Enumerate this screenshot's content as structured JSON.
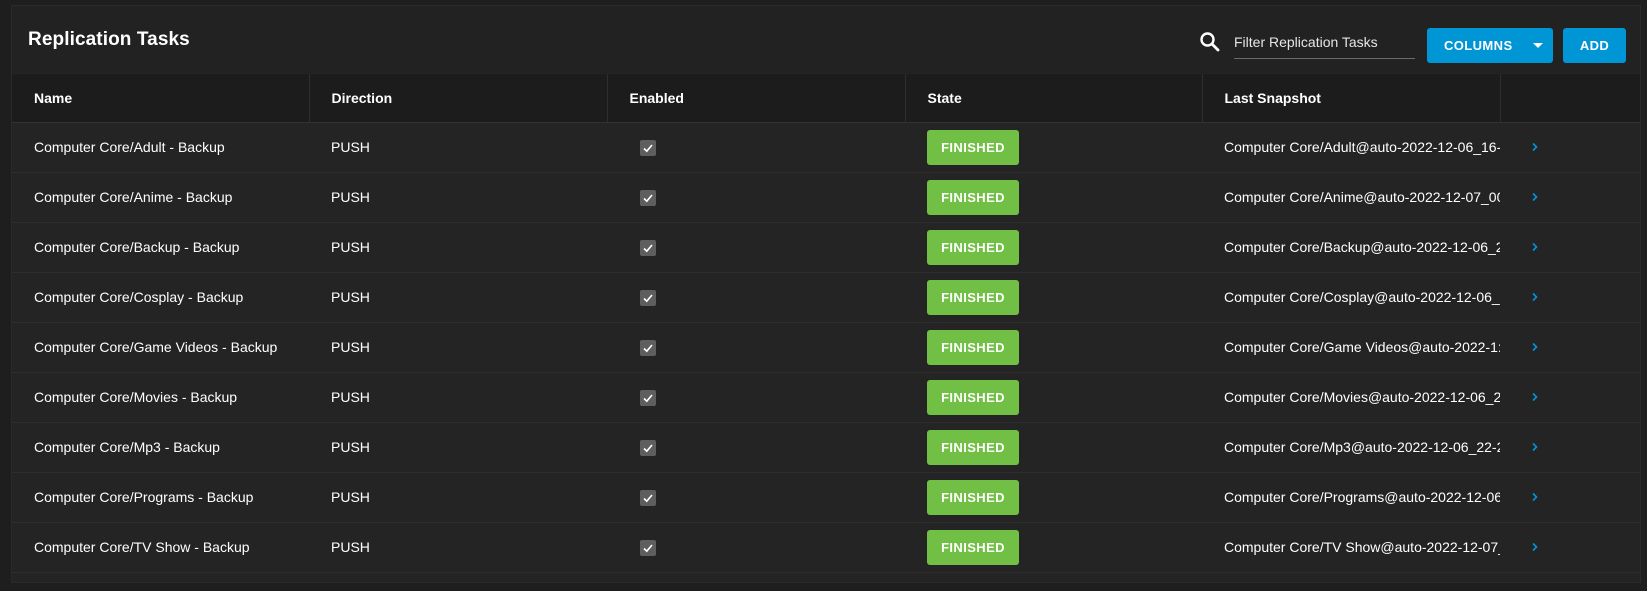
{
  "header": {
    "title": "Replication Tasks",
    "search_placeholder": "Filter Replication Tasks",
    "search_value": "",
    "columns_label": "COLUMNS",
    "add_label": "ADD"
  },
  "table": {
    "columns": [
      "Name",
      "Direction",
      "Enabled",
      "State",
      "Last Snapshot"
    ],
    "rows": [
      {
        "name": "Computer Core/Adult - Backup",
        "direction": "PUSH",
        "enabled": true,
        "state": "FINISHED",
        "last_snapshot": "Computer Core/Adult@auto-2022-12-06_16-"
      },
      {
        "name": "Computer Core/Anime - Backup",
        "direction": "PUSH",
        "enabled": true,
        "state": "FINISHED",
        "last_snapshot": "Computer Core/Anime@auto-2022-12-07_00"
      },
      {
        "name": "Computer Core/Backup - Backup",
        "direction": "PUSH",
        "enabled": true,
        "state": "FINISHED",
        "last_snapshot": "Computer Core/Backup@auto-2022-12-06_2"
      },
      {
        "name": "Computer Core/Cosplay - Backup",
        "direction": "PUSH",
        "enabled": true,
        "state": "FINISHED",
        "last_snapshot": "Computer Core/Cosplay@auto-2022-12-06_"
      },
      {
        "name": "Computer Core/Game Videos - Backup",
        "direction": "PUSH",
        "enabled": true,
        "state": "FINISHED",
        "last_snapshot": "Computer Core/Game Videos@auto-2022-1:"
      },
      {
        "name": "Computer Core/Movies - Backup",
        "direction": "PUSH",
        "enabled": true,
        "state": "FINISHED",
        "last_snapshot": "Computer Core/Movies@auto-2022-12-06_2"
      },
      {
        "name": "Computer Core/Mp3 - Backup",
        "direction": "PUSH",
        "enabled": true,
        "state": "FINISHED",
        "last_snapshot": "Computer Core/Mp3@auto-2022-12-06_22-2"
      },
      {
        "name": "Computer Core/Programs - Backup",
        "direction": "PUSH",
        "enabled": true,
        "state": "FINISHED",
        "last_snapshot": "Computer Core/Programs@auto-2022-12-06"
      },
      {
        "name": "Computer Core/TV Show - Backup",
        "direction": "PUSH",
        "enabled": true,
        "state": "FINISHED",
        "last_snapshot": "Computer Core/TV Show@auto-2022-12-07_"
      }
    ]
  },
  "icons": {
    "search": "search-icon",
    "dropdown": "caret-down-icon",
    "checkbox": "check-icon",
    "expand": "chevron-right-icon"
  },
  "colors": {
    "background": "#1e1e1e",
    "card": "#242424",
    "header_row": "#1c1c1c",
    "primary_button": "#0095d5",
    "finished_badge": "#71bf44",
    "chevron": "#0095d5",
    "checkbox": "#5e5e5e"
  }
}
